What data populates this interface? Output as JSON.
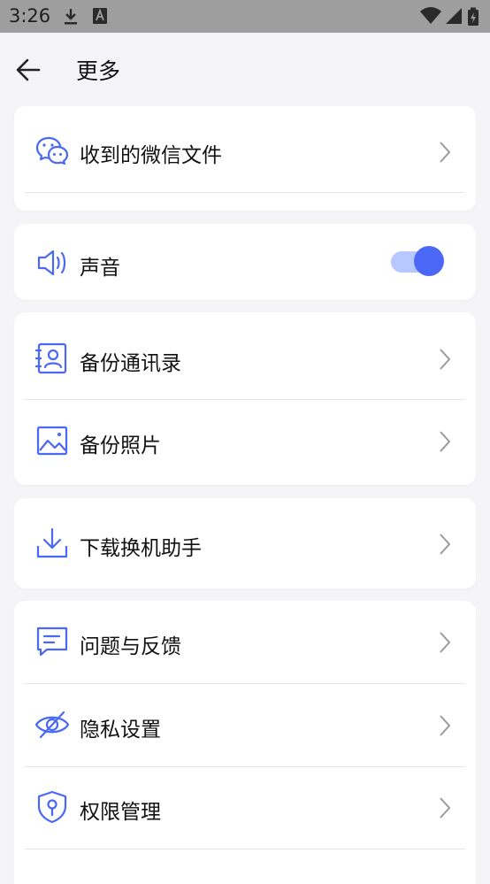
{
  "status_bar": {
    "time": "3:26"
  },
  "header": {
    "title": "更多"
  },
  "colors": {
    "accent": "#4a68f5",
    "toggle_track": "#b6c8ff"
  },
  "sections": [
    {
      "items": [
        {
          "label": "收到的微信文件",
          "icon": "wechat-icon"
        }
      ]
    },
    {
      "items": [
        {
          "label": "声音",
          "icon": "speaker-icon",
          "toggle_on": true
        }
      ]
    },
    {
      "items": [
        {
          "label": "备份通讯录",
          "icon": "contacts-icon"
        },
        {
          "label": "备份照片",
          "icon": "photo-icon"
        }
      ]
    },
    {
      "items": [
        {
          "label": "下载换机助手",
          "icon": "download-icon"
        }
      ]
    },
    {
      "items": [
        {
          "label": "问题与反馈",
          "icon": "feedback-icon"
        },
        {
          "label": "隐私设置",
          "icon": "eye-hidden-icon"
        },
        {
          "label": "权限管理",
          "icon": "shield-icon"
        }
      ]
    }
  ]
}
